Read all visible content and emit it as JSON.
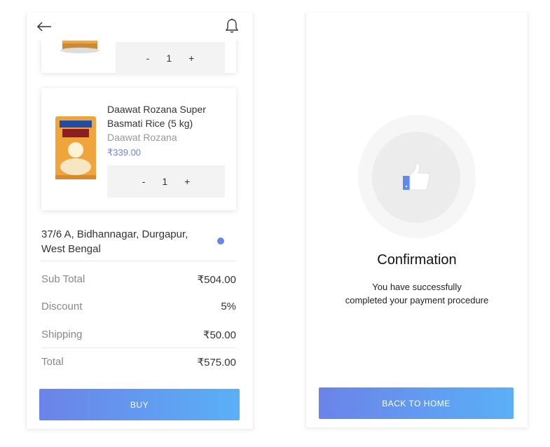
{
  "cart": {
    "items": [
      {
        "quantity": "1",
        "minus": "-",
        "plus": "+"
      },
      {
        "name": "Daawat Rozana Super Basmati Rice (5 kg)",
        "brand": "Daawat Rozana",
        "price": "₹339.00",
        "quantity": "1",
        "minus": "-",
        "plus": "+"
      }
    ],
    "address": "37/6 A, Bidhannagar, Durgapur, West Bengal",
    "summary": {
      "subtotal_label": "Sub Total",
      "subtotal_value": "₹504.00",
      "discount_label": "Discount",
      "discount_value": "5%",
      "shipping_label": "Shipping",
      "shipping_value": "₹50.00",
      "total_label": "Total",
      "total_value": "₹575.00"
    },
    "buy_label": "BUY"
  },
  "confirmation": {
    "title": "Confirmation",
    "message_line1": "You have successfully",
    "message_line2": "completed your payment procedure",
    "button_label": "BACK TO HOME"
  },
  "colors": {
    "accent": "#6a84e6",
    "gradient_start": "#6b83e8",
    "gradient_end": "#5ab0f7"
  },
  "icons": {
    "back": "arrow-left-icon",
    "notification": "bell-icon",
    "success": "thumbs-up-icon"
  }
}
